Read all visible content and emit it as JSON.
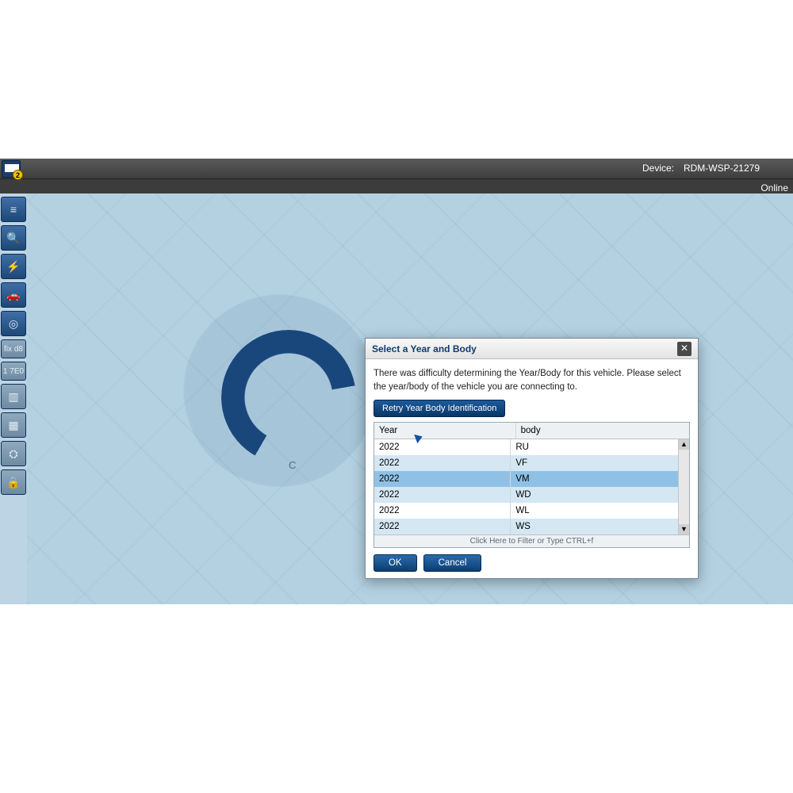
{
  "header": {
    "device_label": "Device:",
    "device_name": "RDM-WSP-21279",
    "status": "Online",
    "notif_count": "2"
  },
  "sidebar": {
    "items": [
      {
        "name": "menu-icon",
        "glyph": "≡",
        "dim": false
      },
      {
        "name": "search-icon",
        "glyph": "🔍",
        "dim": false
      },
      {
        "name": "flash-icon",
        "glyph": "⚡",
        "dim": false
      },
      {
        "name": "vehicle-icon",
        "glyph": "🚗",
        "dim": false
      },
      {
        "name": "radar-icon",
        "glyph": "◎",
        "dim": false
      },
      {
        "name": "code-chip-1",
        "glyph": "fix d8",
        "dim": true,
        "tiny": true
      },
      {
        "name": "code-chip-2",
        "glyph": "1 7E0",
        "dim": true,
        "tiny": true
      },
      {
        "name": "columns-icon",
        "glyph": "▥",
        "dim": true
      },
      {
        "name": "grid-icon",
        "glyph": "▦",
        "dim": true
      },
      {
        "name": "tools-icon",
        "glyph": "⛭",
        "dim": true
      },
      {
        "name": "lock-icon",
        "glyph": "🔒",
        "dim": true
      }
    ]
  },
  "brand": {
    "subtitle": "C"
  },
  "dialog": {
    "title": "Select a Year and Body",
    "message": "There was difficulty determining the Year/Body for this vehicle. Please select the year/body of the vehicle you are connecting to.",
    "retry_label": "Retry Year Body Identification",
    "columns": {
      "year": "Year",
      "body": "body"
    },
    "rows": [
      {
        "year": "2022",
        "body": "RU",
        "selected": false
      },
      {
        "year": "2022",
        "body": "VF",
        "selected": false
      },
      {
        "year": "2022",
        "body": "VM",
        "selected": true
      },
      {
        "year": "2022",
        "body": "WD",
        "selected": false
      },
      {
        "year": "2022",
        "body": "WL",
        "selected": false
      },
      {
        "year": "2022",
        "body": "WS",
        "selected": false
      }
    ],
    "filter_hint": "Click Here to Filter or Type CTRL+f",
    "ok_label": "OK",
    "cancel_label": "Cancel"
  }
}
